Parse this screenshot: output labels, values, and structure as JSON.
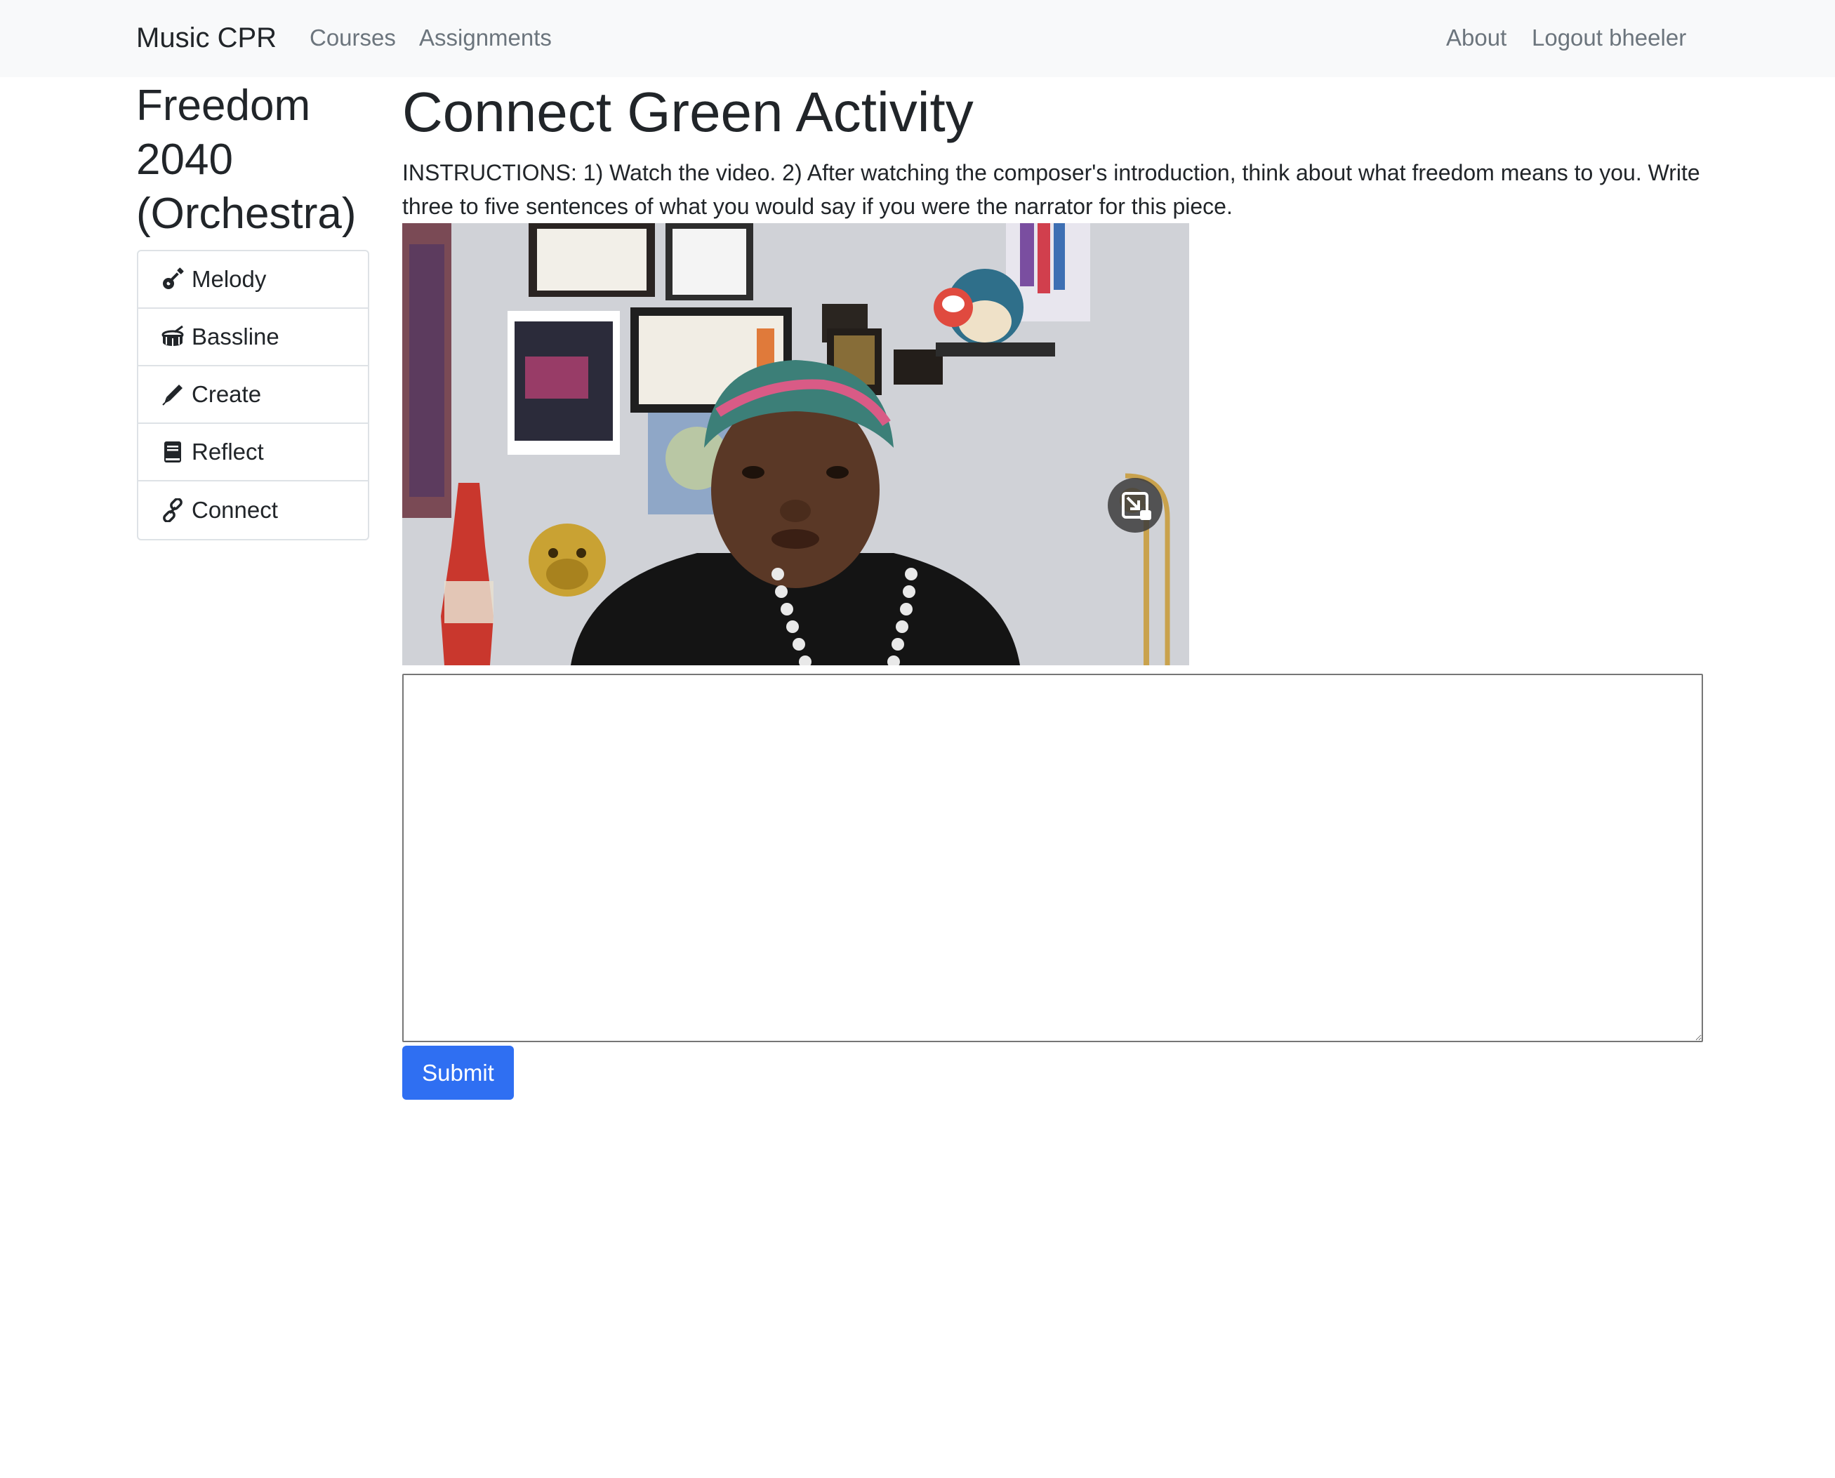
{
  "navbar": {
    "brand": "Music CPR",
    "left_links": [
      "Courses",
      "Assignments"
    ],
    "right_links": [
      "About",
      "Logout bheeler"
    ]
  },
  "sidebar": {
    "title": "Freedom 2040 (Orchestra)",
    "items": [
      {
        "label": "Melody",
        "icon": "guitar-icon"
      },
      {
        "label": "Bassline",
        "icon": "drum-icon"
      },
      {
        "label": "Create",
        "icon": "pen-icon"
      },
      {
        "label": "Reflect",
        "icon": "book-icon"
      },
      {
        "label": "Connect",
        "icon": "link-icon"
      }
    ]
  },
  "main": {
    "title": "Connect Green Activity",
    "instructions": "INSTRUCTIONS: 1) Watch the video. 2) After watching the composer's introduction, think about what freedom means to you. Write three to five sentences of what you would say if you were the narrator for this piece.",
    "answer_value": "",
    "submit_label": "Submit"
  },
  "colors": {
    "navbar_bg": "#f8f9fa",
    "primary": "#2f6ff2",
    "muted_link": "#6c757d"
  }
}
